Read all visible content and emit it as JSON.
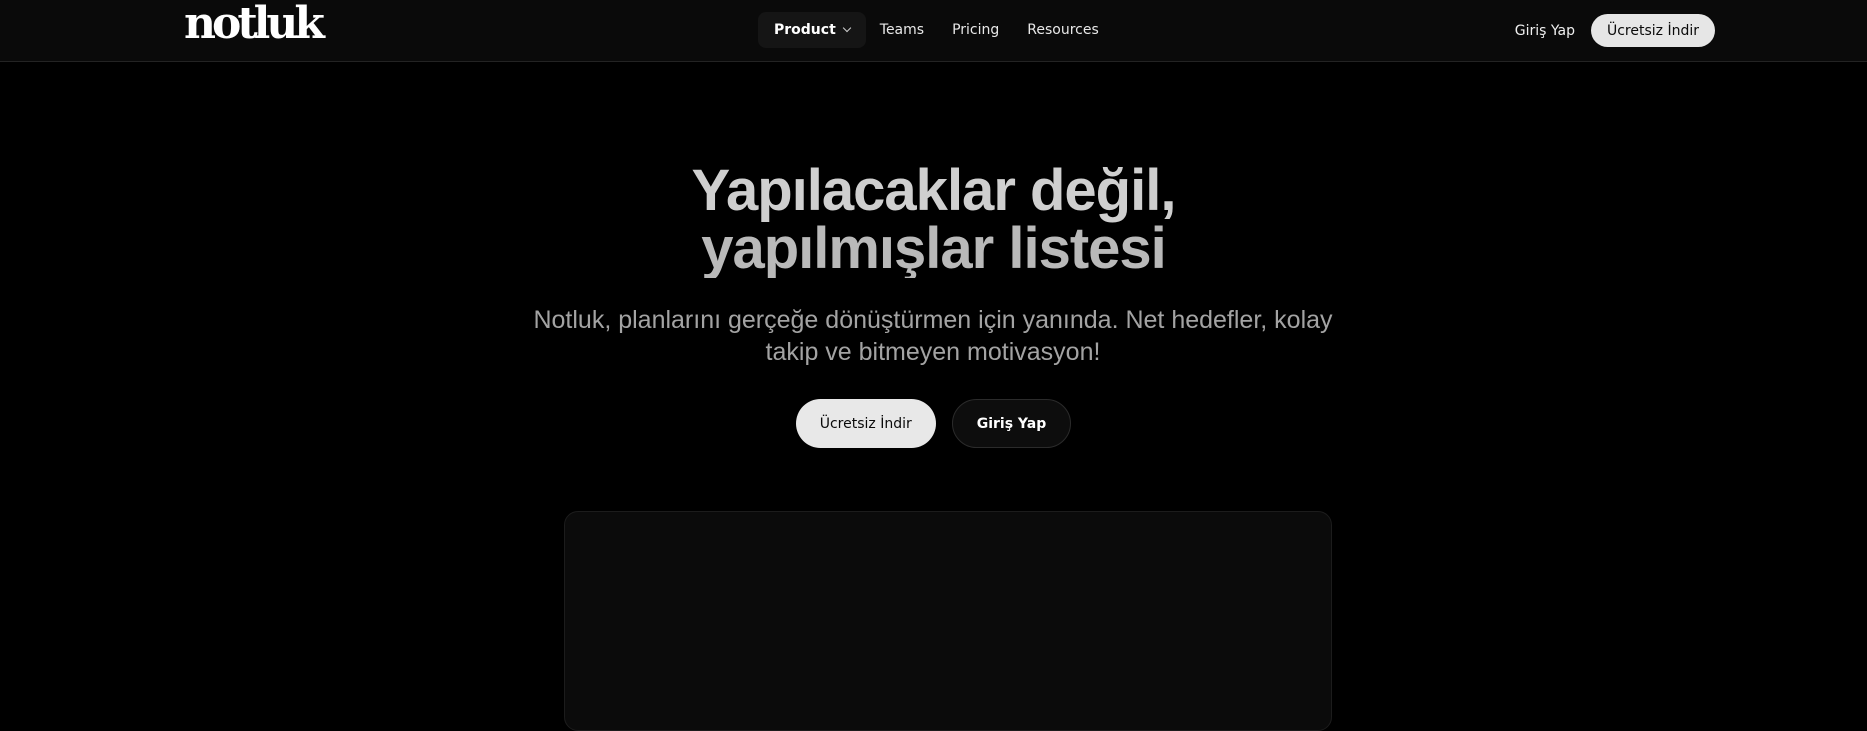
{
  "nav": {
    "logo": "notluk",
    "items": [
      {
        "label": "Product",
        "active": true,
        "has_dropdown": true
      },
      {
        "label": "Teams",
        "active": false
      },
      {
        "label": "Pricing",
        "active": false
      },
      {
        "label": "Resources",
        "active": false
      }
    ],
    "login_label": "Giriş Yap",
    "cta_label": "Ücretsiz İndir"
  },
  "hero": {
    "title_line1": "Yapılacaklar değil,",
    "title_line2": "yapılmışlar listesi",
    "subtitle": "Notluk, planlarını gerçeğe dönüştürmen için yanında. Net hedefler, kolay takip ve bitmeyen motivasyon!",
    "primary_button": "Ücretsiz İndir",
    "secondary_button": "Giriş Yap"
  },
  "icons": {
    "product_dropdown": "chevron-down-icon"
  },
  "colors": {
    "background": "#000000",
    "navbar": "#0a0a0a",
    "primary_button_bg": "#e8e8e8",
    "title_text": "#cfcfcf",
    "subtitle_text": "#a3a3a3"
  }
}
